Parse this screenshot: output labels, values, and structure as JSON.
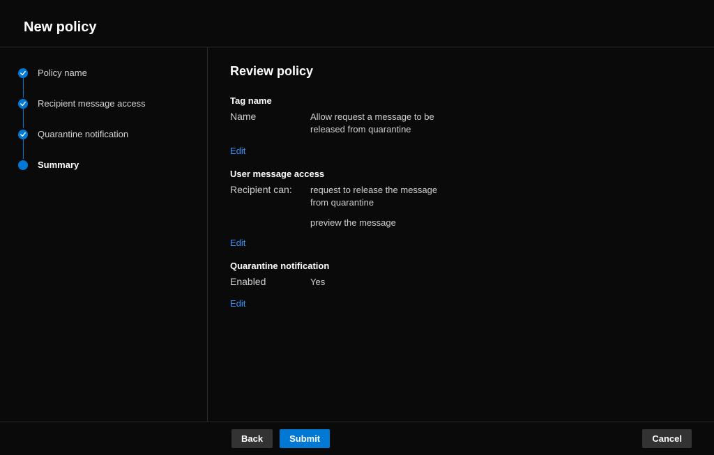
{
  "header": {
    "title": "New policy"
  },
  "steps": [
    {
      "label": "Policy name",
      "state": "completed"
    },
    {
      "label": "Recipient message access",
      "state": "completed"
    },
    {
      "label": "Quarantine notification",
      "state": "completed"
    },
    {
      "label": "Summary",
      "state": "current"
    }
  ],
  "main": {
    "title": "Review policy",
    "sections": {
      "tag": {
        "heading": "Tag name",
        "name_label": "Name",
        "name_value": "Allow request a message to be released from quarantine",
        "edit_label": "Edit"
      },
      "access": {
        "heading": "User message access",
        "recipient_label": "Recipient can:",
        "recipient_value1": "request to release the message from quarantine",
        "recipient_value2": "preview the message",
        "edit_label": "Edit"
      },
      "notification": {
        "heading": "Quarantine notification",
        "enabled_label": "Enabled",
        "enabled_value": "Yes",
        "edit_label": "Edit"
      }
    }
  },
  "footer": {
    "back": "Back",
    "submit": "Submit",
    "cancel": "Cancel"
  }
}
